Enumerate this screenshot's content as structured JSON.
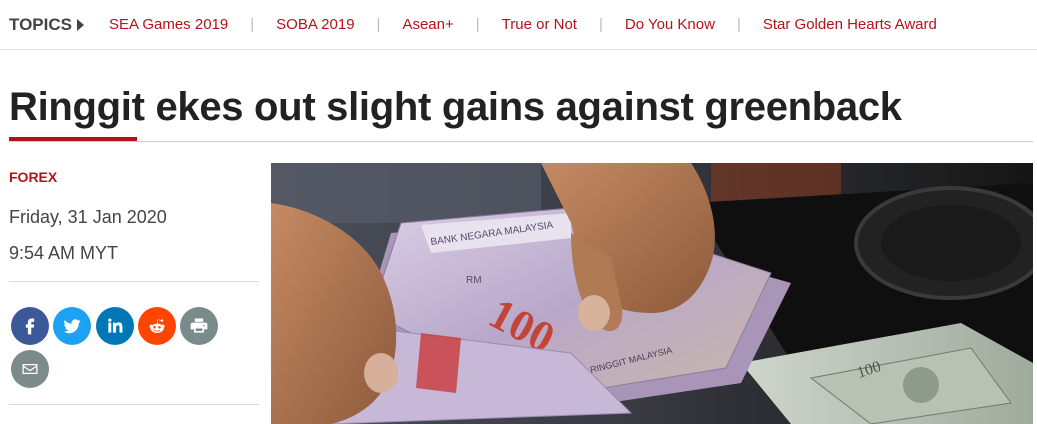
{
  "topics": {
    "label": "TOPICS",
    "items": [
      {
        "label": "SEA Games 2019"
      },
      {
        "label": "SOBA 2019"
      },
      {
        "label": "Asean+"
      },
      {
        "label": "True or Not"
      },
      {
        "label": "Do You Know"
      },
      {
        "label": "Star Golden Hearts Award"
      }
    ]
  },
  "article": {
    "headline": "Ringgit ekes out slight gains against greenback",
    "category": "FOREX",
    "date": "Friday, 31 Jan 2020",
    "time": "9:54 AM MYT"
  },
  "share": {
    "buttons": [
      {
        "name": "facebook",
        "icon": "facebook-icon"
      },
      {
        "name": "twitter",
        "icon": "twitter-icon"
      },
      {
        "name": "linkedin",
        "icon": "linkedin-icon"
      },
      {
        "name": "reddit",
        "icon": "reddit-icon"
      },
      {
        "name": "print",
        "icon": "printer-icon"
      },
      {
        "name": "email",
        "icon": "envelope-icon"
      }
    ]
  },
  "hero_image": {
    "banknote_text": {
      "bank": "BANK NEGARA MALAYSIA",
      "denomination": "100",
      "rm": "RM",
      "currency": "RINGGIT MALAYSIA",
      "usd_denomination": "100"
    }
  },
  "colors": {
    "accent": "#b5121b",
    "facebook": "#3b5998",
    "twitter": "#1da1f2",
    "linkedin": "#0077b5",
    "reddit": "#ff4500",
    "neutral_button": "#7b8a8b"
  }
}
